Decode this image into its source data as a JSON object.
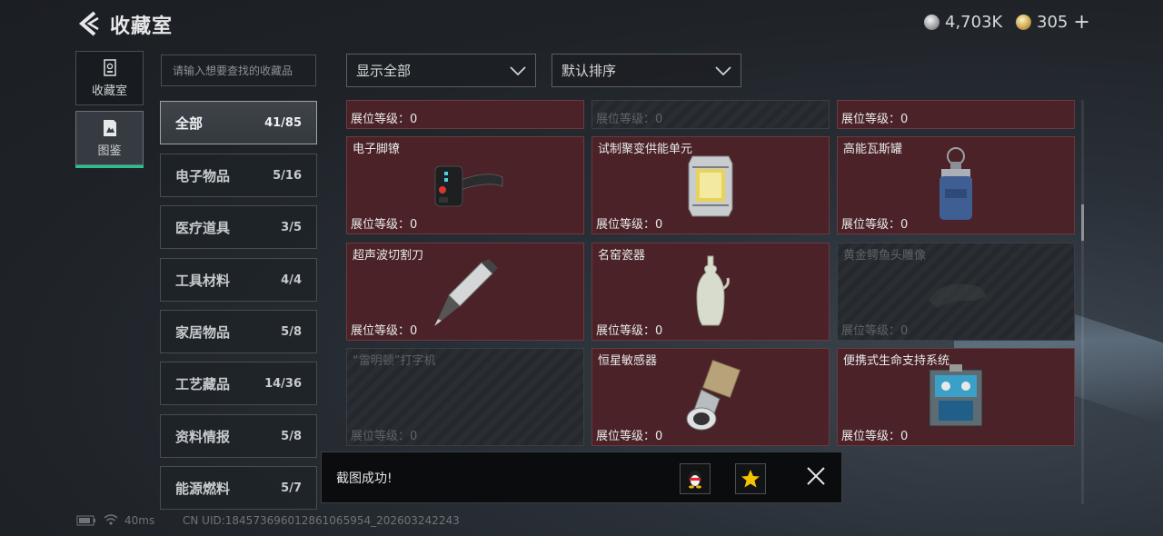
{
  "header": {
    "title": "收藏室",
    "currency": [
      {
        "icon": "silver-coin-icon",
        "value": "4,703K"
      },
      {
        "icon": "gold-coin-icon",
        "value": "305"
      }
    ],
    "add_symbol": "+"
  },
  "rail": [
    {
      "label": "收藏室",
      "icon": "collection-room-icon",
      "active": false
    },
    {
      "label": "图鉴",
      "icon": "codex-icon",
      "active": true
    }
  ],
  "search": {
    "placeholder": "请输入想要查找的收藏品"
  },
  "categories": [
    {
      "name": "全部",
      "count": "41/85",
      "active": true
    },
    {
      "name": "电子物品",
      "count": "5/16"
    },
    {
      "name": "医疗道具",
      "count": "3/5"
    },
    {
      "name": "工具材料",
      "count": "4/4"
    },
    {
      "name": "家居物品",
      "count": "5/8"
    },
    {
      "name": "工艺藏品",
      "count": "14/36"
    },
    {
      "name": "资料情报",
      "count": "5/8"
    },
    {
      "name": "能源燃料",
      "count": "5/7"
    }
  ],
  "filters": {
    "show": "显示全部",
    "sort": "默认排序"
  },
  "level_label": "展位等级：0",
  "items": [
    {
      "name": "",
      "locked": false
    },
    {
      "name": "",
      "locked": true
    },
    {
      "name": "",
      "locked": false
    },
    {
      "name": "电子脚镣",
      "locked": false,
      "icon": "ankle-monitor-icon"
    },
    {
      "name": "试制聚变供能单元",
      "locked": false,
      "icon": "fusion-cell-icon"
    },
    {
      "name": "高能瓦斯罐",
      "locked": false,
      "icon": "gas-canister-icon"
    },
    {
      "name": "超声波切割刀",
      "locked": false,
      "icon": "ultrasonic-cutter-icon"
    },
    {
      "name": "名窑瓷器",
      "locked": false,
      "icon": "porcelain-vase-icon"
    },
    {
      "name": "黄金鳄鱼头雕像",
      "locked": true,
      "icon": "crocodile-statue-icon"
    },
    {
      "name": "“雷明顿”打字机",
      "locked": true,
      "icon": "typewriter-icon"
    },
    {
      "name": "恒星敏感器",
      "locked": false,
      "icon": "star-sensor-icon"
    },
    {
      "name": "便携式生命支持系统",
      "locked": false,
      "icon": "life-support-icon"
    }
  ],
  "toast": {
    "message": "截图成功!"
  },
  "status": {
    "ping": "40ms",
    "uid": "CN UID:1845736960128610659​54_202603242243"
  }
}
